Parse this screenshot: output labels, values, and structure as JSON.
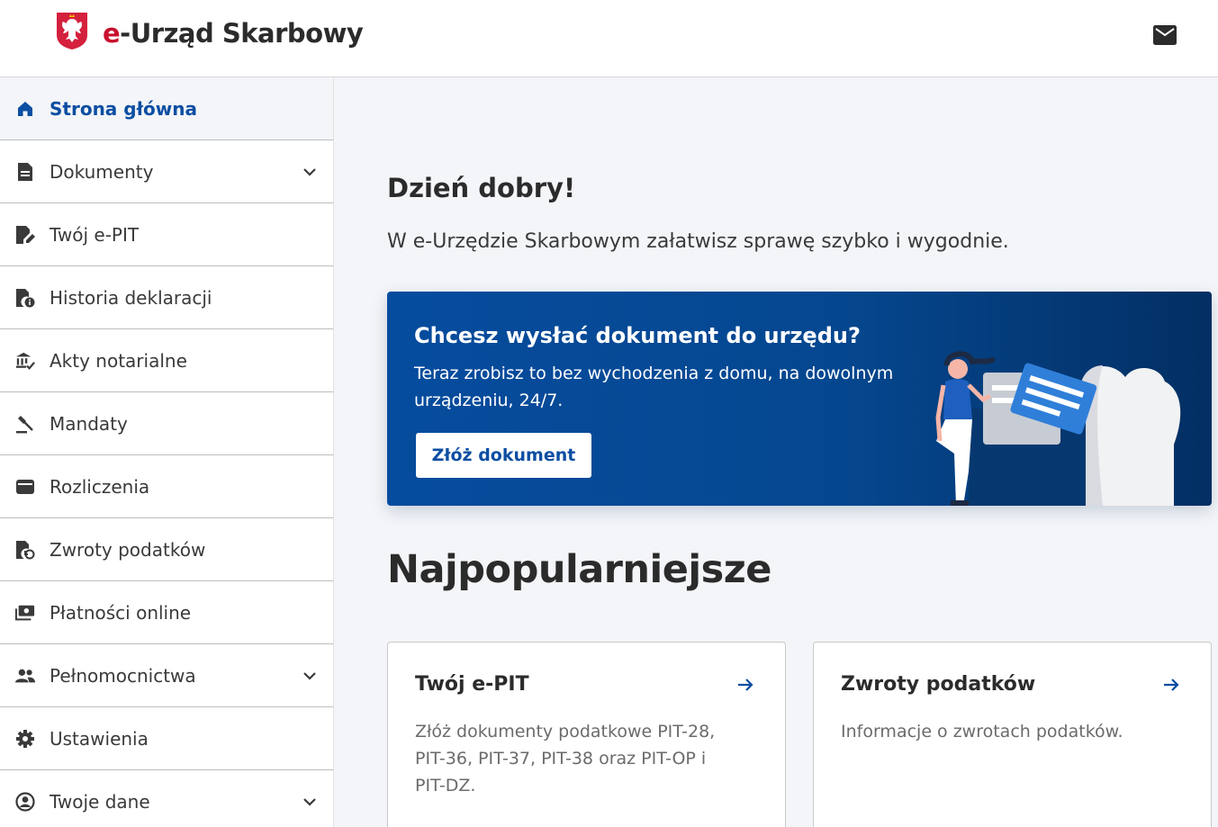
{
  "header": {
    "brand_prefix": "e",
    "brand_rest": "-Urząd Skarbowy",
    "emblem_icon": "polish-eagle-emblem",
    "mail_icon": "mail-icon",
    "brand_color": "#c8102e"
  },
  "sidebar": {
    "items": [
      {
        "label": "Strona główna",
        "icon": "home-icon",
        "active": true,
        "expandable": false
      },
      {
        "label": "Dokumenty",
        "icon": "document-icon",
        "active": false,
        "expandable": true
      },
      {
        "label": "Twój e-PIT",
        "icon": "document-edit-icon",
        "active": false,
        "expandable": false
      },
      {
        "label": "Historia deklaracji",
        "icon": "document-info-icon",
        "active": false,
        "expandable": false
      },
      {
        "label": "Akty notarialne",
        "icon": "bank-check-icon",
        "active": false,
        "expandable": false
      },
      {
        "label": "Mandaty",
        "icon": "gavel-icon",
        "active": false,
        "expandable": false
      },
      {
        "label": "Rozliczenia",
        "icon": "wallet-icon",
        "active": false,
        "expandable": false
      },
      {
        "label": "Zwroty podatków",
        "icon": "document-refund-icon",
        "active": false,
        "expandable": false
      },
      {
        "label": "Płatności online",
        "icon": "payments-icon",
        "active": false,
        "expandable": false
      },
      {
        "label": "Pełnomocnictwa",
        "icon": "people-icon",
        "active": false,
        "expandable": true
      },
      {
        "label": "Ustawienia",
        "icon": "gear-icon",
        "active": false,
        "expandable": false
      },
      {
        "label": "Twoje dane",
        "icon": "user-circle-icon",
        "active": false,
        "expandable": true
      }
    ]
  },
  "main": {
    "greeting": "Dzień dobry!",
    "lead": "W e-Urzędzie Skarbowym załatwisz sprawę szybko i wygodnie.",
    "banner": {
      "title": "Chcesz wysłać dokument do urzędu?",
      "text": "Teraz zrobisz to bez wychodzenia z domu, na dowolnym urządzeniu, 24/7.",
      "button": "Złóż dokument"
    },
    "popular_heading": "Najpopularniejsze",
    "cards": [
      {
        "title": "Twój e-PIT",
        "desc": "Złóż dokumenty podatkowe PIT-28, PIT-36, PIT-37, PIT-38 oraz PIT-OP i PIT-DZ."
      },
      {
        "title": "Zwroty podatków",
        "desc": "Informacje o zwrotach podatków."
      }
    ]
  },
  "colors": {
    "accent": "#0b4ea2",
    "banner_blue": "#064c9e",
    "background": "#f3f5f8"
  }
}
